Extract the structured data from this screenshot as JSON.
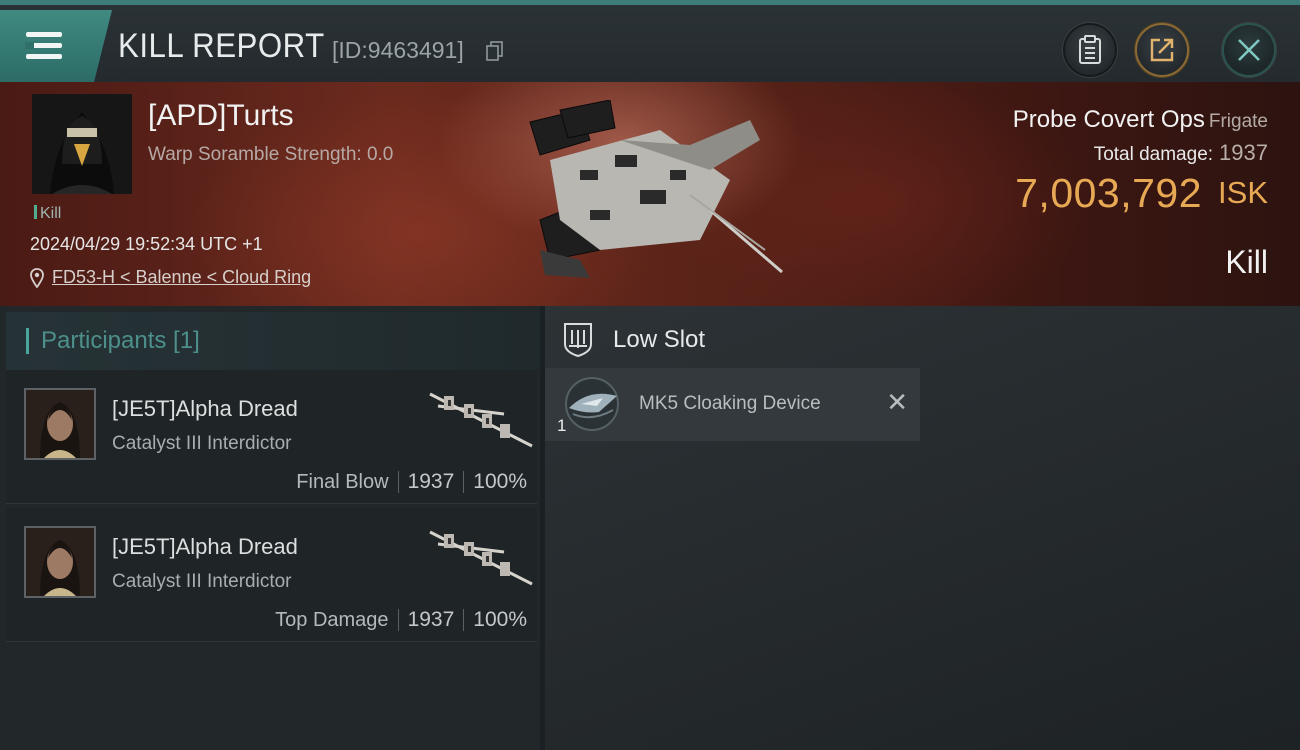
{
  "header": {
    "title": "KILL REPORT",
    "report_id": "[ID:9463491]",
    "icons": [
      "menu-icon",
      "copy-icon",
      "clipboard-icon",
      "share-icon",
      "close-icon"
    ]
  },
  "victim": {
    "name": "[APD]Turts",
    "warp_scramble": "Warp Soramble Strength: 0.0",
    "tag": "Kill",
    "datetime": "2024/04/29 19:52:34 UTC +1",
    "location": "FD53-H < Balenne < Cloud Ring",
    "ship_name": "Probe Covert Ops",
    "ship_class": "Frigate",
    "total_damage_label": "Total damage:",
    "total_damage": "1937",
    "isk_value": "7,003,792",
    "isk_unit": "ISK",
    "result": "Kill"
  },
  "participants": {
    "header": "Participants [1]",
    "items": [
      {
        "name": "[JE5T]Alpha Dread",
        "ship": "Catalyst III Interdictor",
        "label": "Final Blow",
        "damage": "1937",
        "percent": "100%"
      },
      {
        "name": "[JE5T]Alpha Dread",
        "ship": "Catalyst III Interdictor",
        "label": "Top Damage",
        "damage": "1937",
        "percent": "100%"
      }
    ]
  },
  "fitting": {
    "slot_title": "Low Slot",
    "modules": [
      {
        "qty": "1",
        "name": "MK5 Cloaking Device",
        "status_icon": "destroyed-x-icon"
      }
    ]
  },
  "colors": {
    "accent": "#3d7d79",
    "isk": "#e8a955",
    "participants_header": "#4d8f8b"
  }
}
